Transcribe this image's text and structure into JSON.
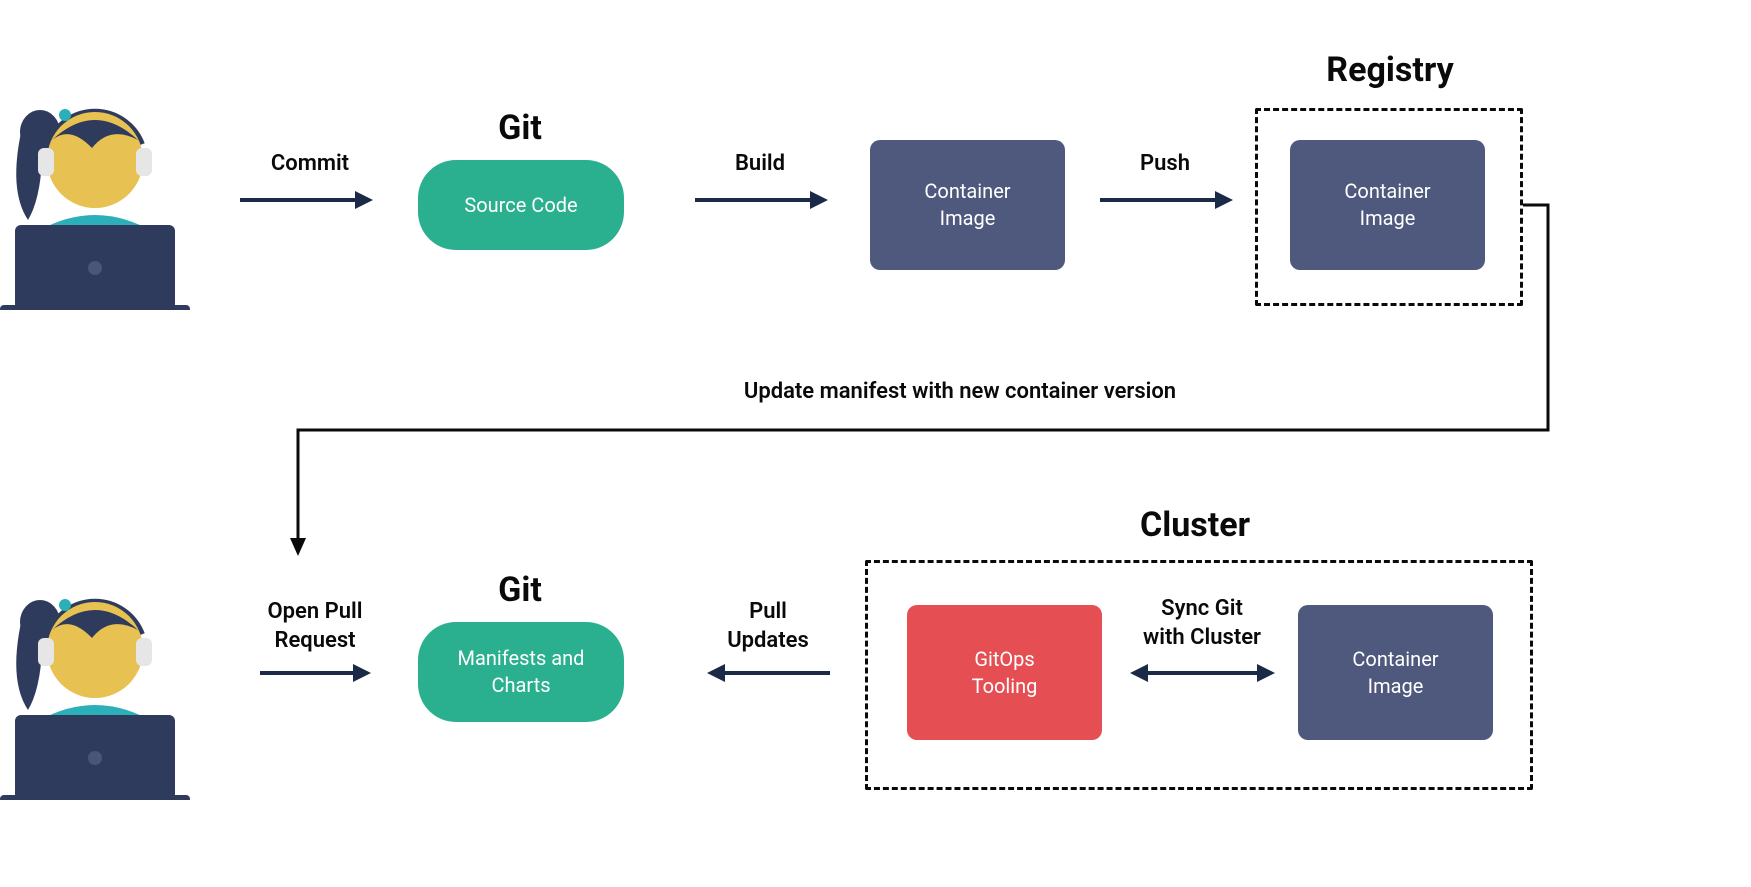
{
  "row1": {
    "arrow_commit": "Commit",
    "git_title": "Git",
    "git_node": "Source Code",
    "arrow_build": "Build",
    "container_image_1": "Container\nImage",
    "arrow_push": "Push",
    "registry_title": "Registry",
    "container_image_2": "Container\nImage"
  },
  "connector": {
    "update_label": "Update manifest with new container version"
  },
  "row2": {
    "arrow_pr": "Open Pull\nRequest",
    "git_title": "Git",
    "git_node": "Manifests and\nCharts",
    "arrow_pull": "Pull\nUpdates",
    "cluster_title": "Cluster",
    "gitops_node": "GitOps\nTooling",
    "arrow_sync": "Sync Git\nwith Cluster",
    "container_image_3": "Container\nImage"
  }
}
